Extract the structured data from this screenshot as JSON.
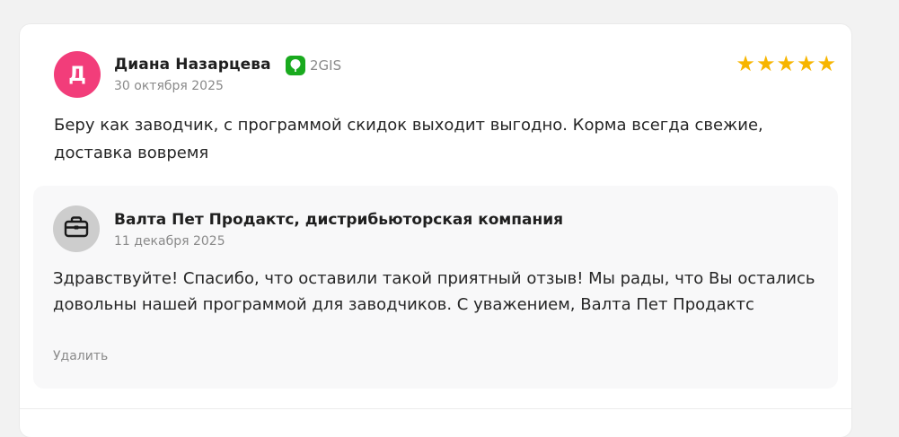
{
  "review": {
    "avatar_letter": "Д",
    "avatar_color": "#f23d7a",
    "author": "Диана Назарцева",
    "source": {
      "icon": "2gis-logo-icon",
      "label": "2GIS",
      "color": "#19aa1e"
    },
    "date": "30 октября 2025",
    "rating": 5,
    "stars": [
      "★",
      "★",
      "★",
      "★",
      "★"
    ],
    "text": "Беру как заводчик, с программой скидок выходит выгодно. Корма всегда свежие, доставка вовремя"
  },
  "reply": {
    "avatar_icon": "briefcase-icon",
    "author": "Валта Пет Продактс, дистрибьюторская компания",
    "date": "11 декабря 2025",
    "text": "Здравствуйте! Спасибо, что оставили такой приятный отзыв! Мы рады, что Вы остались довольны нашей программой для заводчиков. С уважением, Валта Пет Продактс",
    "delete_label": "Удалить"
  }
}
